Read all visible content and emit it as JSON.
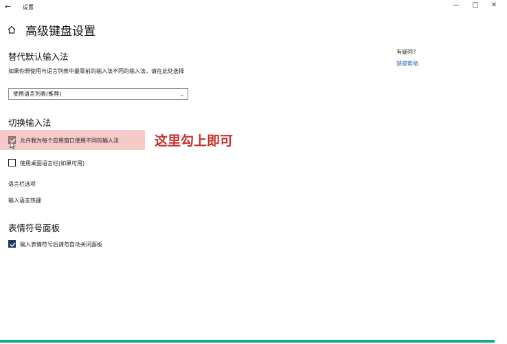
{
  "window": {
    "title": "设置",
    "back_icon": "arrow-left-icon",
    "minimize_icon": "minimize-icon",
    "maximize_icon": "maximize-icon",
    "close_icon": "close-icon"
  },
  "page": {
    "home_icon": "home-icon",
    "title": "高级键盘设置"
  },
  "override_section": {
    "heading": "替代默认输入法",
    "description": "如果你想使用与语言列表中最靠前的输入法不同的输入法，请在此处选择",
    "dropdown_value": "使用语言列表(推荐)"
  },
  "switch_section": {
    "heading": "切换输入法",
    "option1_label": "允许我为每个应用窗口使用不同的输入法",
    "option1_checked": true,
    "option2_label": "使用桌面语言栏(如果可用)",
    "option2_checked": false,
    "link1": "语言栏选项",
    "link2": "输入语言热键"
  },
  "annotation": {
    "text": "这里勾上即可",
    "highlight_color": "#f7caca",
    "text_color": "#c9302c"
  },
  "emoji_section": {
    "heading": "表情符号面板",
    "option_label": "输入表情符号后请勿自动关闭面板",
    "option_checked": true
  },
  "side": {
    "question": "有疑问?",
    "help_link": "获取帮助"
  },
  "colors": {
    "accent": "#1f3b5a",
    "link": "#1a5fb4",
    "bottom_bar": "#17a88a"
  }
}
